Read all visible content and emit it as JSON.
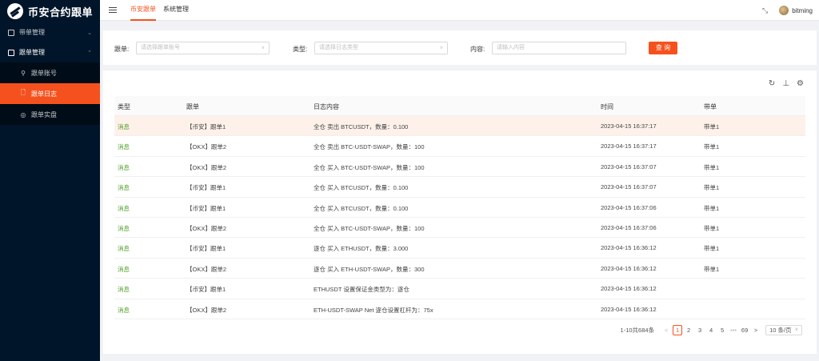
{
  "app": {
    "title": "币安合约跟单"
  },
  "sidebar": {
    "groups": [
      {
        "label": "带单管理",
        "arrow": "⌄"
      },
      {
        "label": "跟单管理",
        "arrow": "⌃"
      }
    ],
    "items": [
      {
        "label": "跟单账号",
        "icon": "⚲"
      },
      {
        "label": "跟单日志",
        "icon": "🗋"
      },
      {
        "label": "跟单实盘",
        "icon": "◎"
      }
    ]
  },
  "header": {
    "tabs": [
      "币安跟单",
      "系统管理"
    ],
    "expand_icon": "⤡",
    "username": "bitming"
  },
  "filters": {
    "account_label": "跟单:",
    "account_placeholder": "请选择跟单账号",
    "type_label": "类型:",
    "type_placeholder": "请选择日志类型",
    "content_label": "内容:",
    "content_placeholder": "请输入内容",
    "query_button": "查 询"
  },
  "toolbar": {
    "refresh_icon": "↻",
    "density_icon": "⊥",
    "settings_icon": "⚙"
  },
  "table": {
    "columns": [
      "类型",
      "跟单",
      "日志内容",
      "时间",
      "带单"
    ],
    "rows": [
      {
        "type": "消息",
        "account": "【币安】跟单1",
        "content": "全仓 卖出 BTCUSDT，数量：0.100",
        "time": "2023-04-15 16:37:17",
        "leader": "带单1"
      },
      {
        "type": "消息",
        "account": "【OKX】跟单2",
        "content": "全仓 卖出 BTC-USDT-SWAP，数量：100",
        "time": "2023-04-15 16:37:17",
        "leader": "带单1"
      },
      {
        "type": "消息",
        "account": "【OKX】跟单2",
        "content": "全仓 买入 BTC-USDT-SWAP，数量：100",
        "time": "2023-04-15 16:37:07",
        "leader": "带单1"
      },
      {
        "type": "消息",
        "account": "【币安】跟单1",
        "content": "全仓 买入 BTCUSDT，数量：0.100",
        "time": "2023-04-15 16:37:07",
        "leader": "带单1"
      },
      {
        "type": "消息",
        "account": "【币安】跟单1",
        "content": "全仓 买入 BTCUSDT，数量：0.100",
        "time": "2023-04-15 16:37:06",
        "leader": "带单1"
      },
      {
        "type": "消息",
        "account": "【OKX】跟单2",
        "content": "全仓 买入 BTC-USDT-SWAP，数量：100",
        "time": "2023-04-15 16:37:06",
        "leader": "带单1"
      },
      {
        "type": "消息",
        "account": "【币安】跟单1",
        "content": "逐仓 买入 ETHUSDT，数量：3.000",
        "time": "2023-04-15 16:36:12",
        "leader": "带单1"
      },
      {
        "type": "消息",
        "account": "【OKX】跟单2",
        "content": "逐仓 买入 ETH-USDT-SWAP，数量：300",
        "time": "2023-04-15 16:36:12",
        "leader": "带单1"
      },
      {
        "type": "消息",
        "account": "【币安】跟单1",
        "content": "ETHUSDT 设置保证金类型为：逐仓",
        "time": "2023-04-15 16:36:12",
        "leader": ""
      },
      {
        "type": "消息",
        "account": "【OKX】跟单2",
        "content": "ETH-USDT-SWAP Net 逐仓设置杠杆为：75x",
        "time": "2023-04-15 16:36:12",
        "leader": ""
      }
    ]
  },
  "pagination": {
    "total": "1-10共684条",
    "prev": "<",
    "pages": [
      "1",
      "2",
      "3",
      "4",
      "5"
    ],
    "ellipsis": "•••",
    "last": "69",
    "next": ">",
    "page_size": "10 条/页",
    "current": "1"
  },
  "colors": {
    "accent": "#f5511e",
    "sidebar": "#001529",
    "type_text": "#52a02a",
    "highlight_row": "#fdf1ea"
  }
}
